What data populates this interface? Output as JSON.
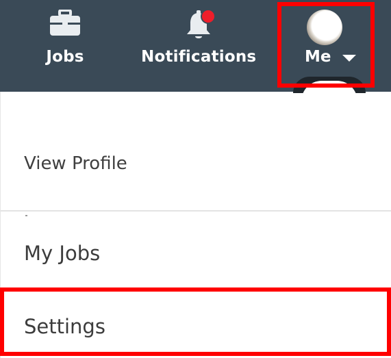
{
  "nav": {
    "jobs_label": "Jobs",
    "notifications_label": "Notifications",
    "me_label": "Me"
  },
  "menu": {
    "items": [
      {
        "label": "View Profile"
      },
      {
        "label": "My Jobs"
      },
      {
        "label": "Settings"
      }
    ]
  },
  "colors": {
    "topbar": "#3a4a57",
    "badge": "#ee1e2a",
    "highlight": "#ff0000"
  },
  "icons": {
    "jobs": "briefcase-icon",
    "notifications": "bell-icon",
    "me": "avatar",
    "caret": "chevron-down-icon"
  }
}
